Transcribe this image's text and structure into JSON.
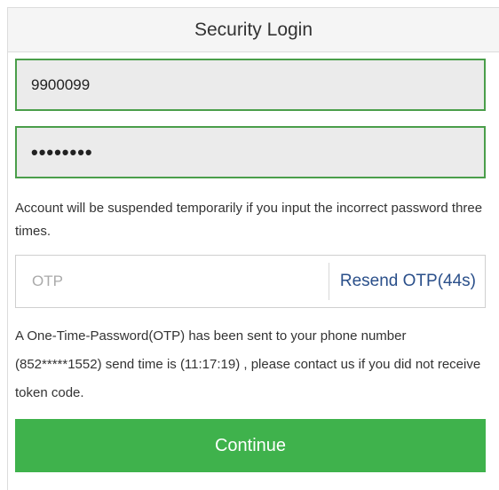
{
  "header": {
    "title": "Security Login"
  },
  "account": {
    "value": "9900099"
  },
  "password": {
    "masked": "••••••••"
  },
  "warning": {
    "text": "Account will be suspended temporarily if you input the incorrect password three times."
  },
  "otp": {
    "placeholder": "OTP",
    "resend_label": "Resend OTP(44s)"
  },
  "info": {
    "text": "A One-Time-Password(OTP) has been sent to your phone number (852*****1552) send time is (11:17:19) , please contact us if you did not receive token code."
  },
  "actions": {
    "continue_label": "Continue"
  },
  "colors": {
    "field_border": "#4a9e4a",
    "button": "#3fb24c",
    "link": "#2a4f8a"
  }
}
